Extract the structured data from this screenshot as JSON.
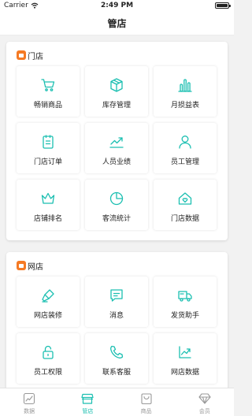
{
  "status_bar": {
    "carrier": "Carrier",
    "time": "2:49 PM"
  },
  "nav": {
    "title": "管店"
  },
  "sections": [
    {
      "title": "门店",
      "items": [
        {
          "label": "畅销商品",
          "icon": "cart-icon"
        },
        {
          "label": "库存管理",
          "icon": "box-icon"
        },
        {
          "label": "月损益表",
          "icon": "bar-chart-icon"
        },
        {
          "label": "门店订单",
          "icon": "clipboard-icon"
        },
        {
          "label": "人员业绩",
          "icon": "trend-line-icon"
        },
        {
          "label": "员工管理",
          "icon": "person-icon"
        },
        {
          "label": "店铺排名",
          "icon": "crown-icon"
        },
        {
          "label": "客流统计",
          "icon": "pie-chart-icon"
        },
        {
          "label": "门店数据",
          "icon": "house-heart-icon"
        }
      ]
    },
    {
      "title": "网店",
      "items": [
        {
          "label": "网店装修",
          "icon": "paint-brush-icon"
        },
        {
          "label": "消息",
          "icon": "message-icon"
        },
        {
          "label": "发货助手",
          "icon": "truck-icon"
        },
        {
          "label": "员工权限",
          "icon": "lock-icon"
        },
        {
          "label": "联系客服",
          "icon": "phone-icon"
        },
        {
          "label": "网店数据",
          "icon": "trend-up-icon"
        }
      ]
    }
  ],
  "tabs": [
    {
      "label": "数据",
      "icon": "chart-tab-icon",
      "active": false
    },
    {
      "label": "管店",
      "icon": "store-tab-icon",
      "active": true
    },
    {
      "label": "商品",
      "icon": "bag-tab-icon",
      "active": false
    },
    {
      "label": "会员",
      "icon": "diamond-tab-icon",
      "active": false
    }
  ],
  "colors": {
    "accent": "#1bbfb1",
    "section_badge": "#f57a24",
    "inactive": "#999999"
  }
}
